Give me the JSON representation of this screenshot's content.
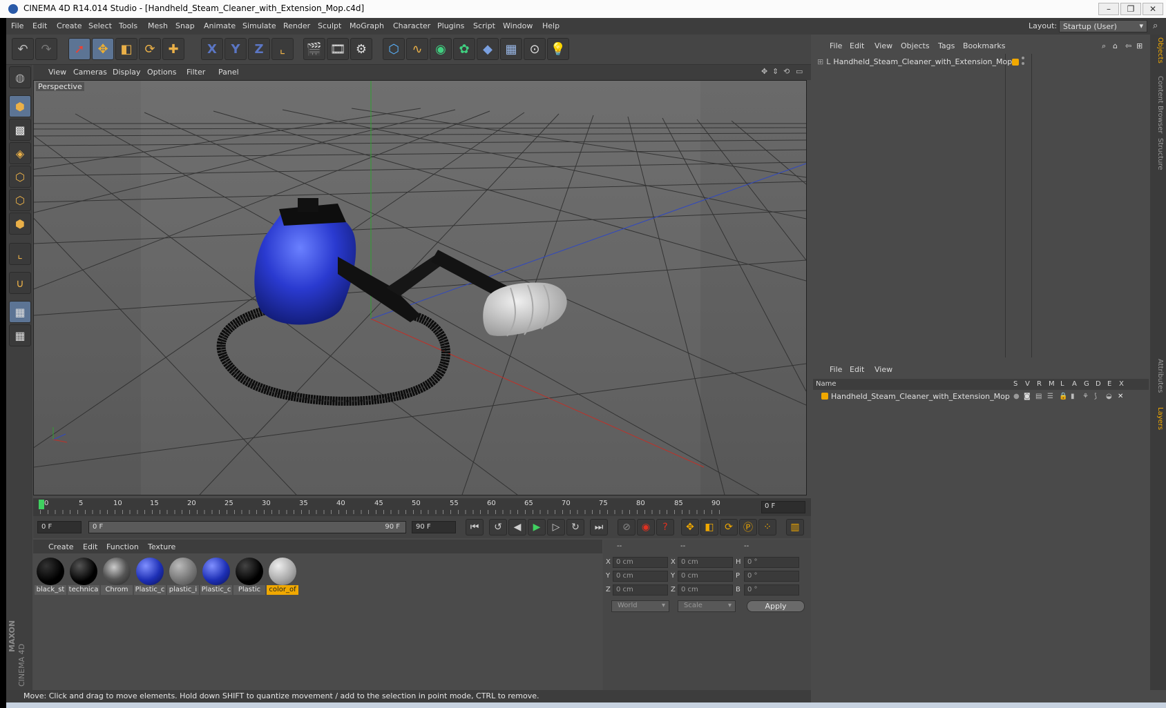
{
  "window": {
    "title": "CINEMA 4D R14.014 Studio - [Handheld_Steam_Cleaner_with_Extension_Mop.c4d]",
    "minimize": "–",
    "restore": "❐",
    "close": "✕"
  },
  "menubar": {
    "items": [
      "File",
      "Edit",
      "Create",
      "Select",
      "Tools",
      "Mesh",
      "Snap",
      "Animate",
      "Simulate",
      "Render",
      "Sculpt",
      "MoGraph",
      "Character",
      "Plugins",
      "Script",
      "Window",
      "Help"
    ],
    "layout_label": "Layout:",
    "layout_value": "Startup (User)"
  },
  "toolbar": {
    "axis_x": "X",
    "axis_y": "Y",
    "axis_z": "Z"
  },
  "viewport": {
    "menu": [
      "View",
      "Cameras",
      "Display",
      "Options",
      "Filter",
      "Panel"
    ],
    "label": "Perspective"
  },
  "timeline": {
    "ticks": [
      "0",
      "5",
      "10",
      "15",
      "20",
      "25",
      "30",
      "35",
      "40",
      "45",
      "50",
      "55",
      "60",
      "65",
      "70",
      "75",
      "80",
      "85",
      "90"
    ],
    "current_frame": "0 F"
  },
  "transport": {
    "start_field": "0 F",
    "range_start": "0 F",
    "range_end": "90 F",
    "end_field": "90 F"
  },
  "materials": {
    "menu": [
      "Create",
      "Edit",
      "Function",
      "Texture"
    ],
    "items": [
      {
        "label": "black_st",
        "color": "#000000"
      },
      {
        "label": "technica",
        "color": "#0a0a0a"
      },
      {
        "label": "Chrom",
        "color": "#7a7a7a"
      },
      {
        "label": "Plastic_c",
        "color": "#1d2fb5"
      },
      {
        "label": "plastic_i",
        "color": "#8a8a8a"
      },
      {
        "label": "Plastic_c",
        "color": "#1d2fb5"
      },
      {
        "label": "Plastic",
        "color": "#050505"
      },
      {
        "label": "color_of",
        "color": "#b5b5b5"
      }
    ]
  },
  "coordinates": {
    "col_headers": [
      "--",
      "--",
      "--"
    ],
    "rows": [
      {
        "l1": "X",
        "v1": "0 cm",
        "l2": "X",
        "v2": "0 cm",
        "l3": "H",
        "v3": "0 °"
      },
      {
        "l1": "Y",
        "v1": "0 cm",
        "l2": "Y",
        "v2": "0 cm",
        "l3": "P",
        "v3": "0 °"
      },
      {
        "l1": "Z",
        "v1": "0 cm",
        "l2": "Z",
        "v2": "0 cm",
        "l3": "B",
        "v3": "0 °"
      }
    ],
    "world": "World",
    "scale": "Scale",
    "apply": "Apply"
  },
  "objects": {
    "menu": [
      "File",
      "Edit",
      "View",
      "Objects",
      "Tags",
      "Bookmarks"
    ],
    "root": "Handheld_Steam_Cleaner_with_Extension_Mop"
  },
  "layers": {
    "menu": [
      "File",
      "Edit",
      "View"
    ],
    "header_name": "Name",
    "columns": [
      "S",
      "V",
      "R",
      "M",
      "L",
      "A",
      "G",
      "D",
      "E",
      "X"
    ],
    "row": "Handheld_Steam_Cleaner_with_Extension_Mop"
  },
  "righttabs": [
    "Objects",
    "Content Browser",
    "Structure",
    "Attributes",
    "Layers"
  ],
  "status": "Move: Click and drag to move elements. Hold down SHIFT to quantize movement / add to the selection in point mode, CTRL to remove.",
  "brand": {
    "line1": "MAXON",
    "line2": "CINEMA 4D"
  },
  "colors": {
    "accent": "#f0a800",
    "steamer_blue": "#2233c8",
    "axis_blue": "#3048c0",
    "axis_red": "#c03028",
    "axis_green": "#30a030"
  }
}
